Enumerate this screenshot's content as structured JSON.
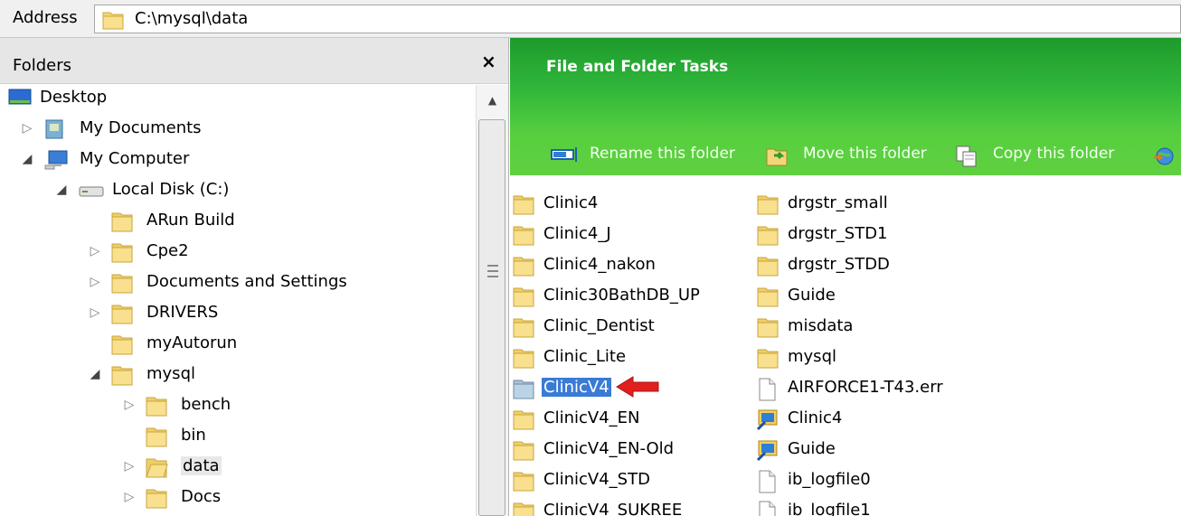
{
  "address": {
    "label": "Address",
    "path": "C:\\mysql\\data"
  },
  "folders_pane": {
    "title": "Folders",
    "close": "×",
    "tree": [
      {
        "label": "Desktop",
        "icon": "desktop-icon",
        "toggle": ""
      },
      {
        "label": "My Documents",
        "icon": "my-documents-icon",
        "toggle": "collapsed"
      },
      {
        "label": "My Computer",
        "icon": "my-computer-icon",
        "toggle": "expanded"
      },
      {
        "label": "Local Disk (C:)",
        "icon": "drive-icon",
        "toggle": "expanded"
      },
      {
        "label": "ARun Build",
        "icon": "folder-icon",
        "toggle": ""
      },
      {
        "label": "Cpe2",
        "icon": "folder-icon",
        "toggle": "collapsed"
      },
      {
        "label": "Documents and Settings",
        "icon": "folder-icon",
        "toggle": "collapsed"
      },
      {
        "label": "DRIVERS",
        "icon": "folder-icon",
        "toggle": "collapsed"
      },
      {
        "label": "myAutorun",
        "icon": "folder-icon",
        "toggle": ""
      },
      {
        "label": "mysql",
        "icon": "folder-icon",
        "toggle": "expanded"
      },
      {
        "label": "bench",
        "icon": "folder-icon",
        "toggle": "collapsed"
      },
      {
        "label": "bin",
        "icon": "folder-icon",
        "toggle": ""
      },
      {
        "label": "data",
        "icon": "open-folder-icon",
        "toggle": "collapsed",
        "selected": true
      },
      {
        "label": "Docs",
        "icon": "folder-icon",
        "toggle": "collapsed"
      }
    ]
  },
  "tasks": {
    "title": "File and Folder Tasks",
    "items": [
      {
        "label": "Rename this folder",
        "icon": "rename-icon"
      },
      {
        "label": "Move this folder",
        "icon": "move-icon"
      },
      {
        "label": "Copy this folder",
        "icon": "copy-icon"
      },
      {
        "label": "",
        "icon": "publish-web-icon"
      }
    ]
  },
  "files": {
    "column1": [
      {
        "label": "Clinic4",
        "icon": "folder-icon"
      },
      {
        "label": "Clinic4_J",
        "icon": "folder-icon"
      },
      {
        "label": "Clinic4_nakon",
        "icon": "folder-icon"
      },
      {
        "label": "Clinic30BathDB_UP",
        "icon": "folder-icon"
      },
      {
        "label": "Clinic_Dentist",
        "icon": "folder-icon"
      },
      {
        "label": "Clinic_Lite",
        "icon": "folder-icon"
      },
      {
        "label": "ClinicV4",
        "icon": "folder-icon",
        "selected": true
      },
      {
        "label": "ClinicV4_EN",
        "icon": "folder-icon"
      },
      {
        "label": "ClinicV4_EN-Old",
        "icon": "folder-icon"
      },
      {
        "label": "ClinicV4_STD",
        "icon": "folder-icon"
      },
      {
        "label": "ClinicV4_SUKREE",
        "icon": "folder-icon"
      }
    ],
    "column2": [
      {
        "label": "drgstr_small",
        "icon": "folder-icon"
      },
      {
        "label": "drgstr_STD1",
        "icon": "folder-icon"
      },
      {
        "label": "drgstr_STDD",
        "icon": "folder-icon"
      },
      {
        "label": "Guide",
        "icon": "folder-icon"
      },
      {
        "label": "misdata",
        "icon": "folder-icon"
      },
      {
        "label": "mysql",
        "icon": "folder-icon"
      },
      {
        "label": "AIRFORCE1-T43.err",
        "icon": "file-icon"
      },
      {
        "label": "Clinic4",
        "icon": "shortcut-icon"
      },
      {
        "label": "Guide",
        "icon": "shortcut-icon"
      },
      {
        "label": "ib_logfile0",
        "icon": "file-icon"
      },
      {
        "label": "ib_logfile1",
        "icon": "file-icon"
      }
    ]
  },
  "colors": {
    "task_green": "#3bbd3a",
    "selection": "#3a7bd5",
    "arrow": "#e0201f"
  }
}
